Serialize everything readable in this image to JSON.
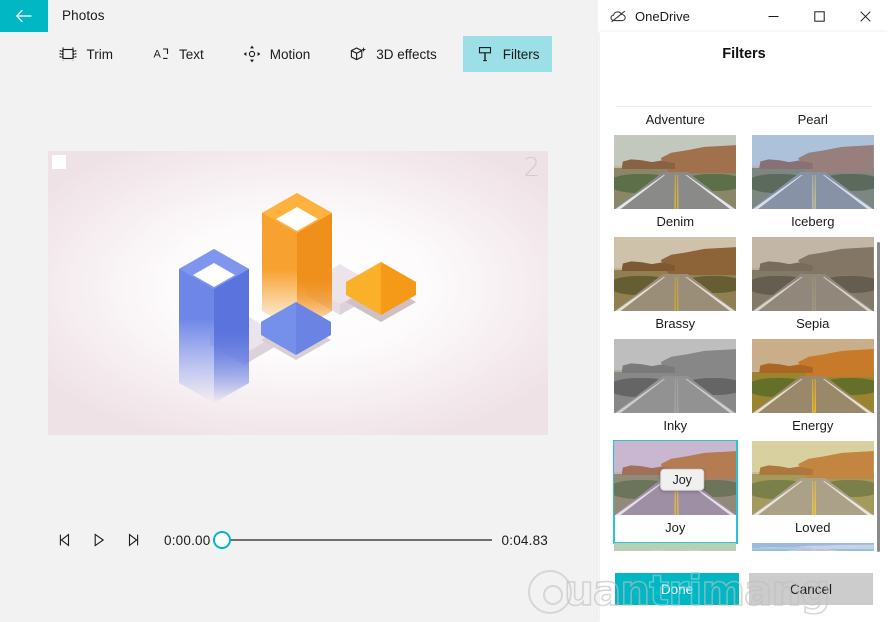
{
  "app": {
    "title": "Photos",
    "back_icon": "back-arrow-icon",
    "accent_color": "#00b7c3"
  },
  "toolbar": {
    "items": [
      {
        "label": "Trim",
        "icon": "trim-icon",
        "selected": false
      },
      {
        "label": "Text",
        "icon": "text-icon",
        "selected": false
      },
      {
        "label": "Motion",
        "icon": "motion-icon",
        "selected": false
      },
      {
        "label": "3D effects",
        "icon": "three-d-effects-icon",
        "selected": false
      },
      {
        "label": "Filters",
        "icon": "filters-brush-icon",
        "selected": true
      }
    ]
  },
  "preview": {
    "badge": "2",
    "corner_mark": "white-square-marker"
  },
  "transport": {
    "prev_frame_icon": "previous-frame-icon",
    "play_icon": "play-icon",
    "next_frame_icon": "next-frame-icon",
    "current_time": "0:00.00",
    "total_time": "0:04.83",
    "thumb_position_pct": 0
  },
  "window": {
    "app_name": "OneDrive",
    "app_icon": "onedrive-cloud-icon",
    "minimize_label": "—",
    "maximize_label": "☐",
    "close_label": "✕"
  },
  "filters_panel": {
    "title": "Filters",
    "selected_filter": "Joy",
    "tooltip": "Joy",
    "filters": [
      {
        "label": "Adventure",
        "thumb_hidden": true,
        "sky": "#b9cbd6",
        "mesa": "#a8764d",
        "rock": "#95683f",
        "ground": "#8f8a6a",
        "bush": "#5f6e44",
        "road": "#8e8d8b",
        "line": "#d8b13c",
        "tint": "rgba(120,90,60,0.08)"
      },
      {
        "label": "Pearl",
        "thumb_hidden": true,
        "sky": "#d6dce6",
        "mesa": "#b99a84",
        "rock": "#a89183",
        "ground": "#b3ad9a",
        "bush": "#8a9179",
        "road": "#aeaeae",
        "line": "#d9c58c",
        "tint": "rgba(235,230,235,0.22)"
      },
      {
        "label": "Denim",
        "sky": "#c9cec2",
        "mesa": "#a5714a",
        "rock": "#8d603d",
        "ground": "#8d8968",
        "bush": "#5d6f45",
        "road": "#8d8c8a",
        "line": "#dbb33f",
        "tint": "rgba(110,120,140,0.06)"
      },
      {
        "label": "Iceberg",
        "sky": "#b9ccdf",
        "mesa": "#9e7a6c",
        "rock": "#8a6a62",
        "ground": "#7e8472",
        "bush": "#566046",
        "road": "#8b92a0",
        "line": "#c7c48e",
        "tint": "rgba(120,150,200,0.18)"
      },
      {
        "label": "Brassy",
        "sky": "#d7cfbd",
        "mesa": "#8a6038",
        "rock": "#775331",
        "ground": "#8d8155",
        "bush": "#5d5a33",
        "road": "#9a9284",
        "line": "#cbab43",
        "tint": "rgba(160,120,55,0.14)"
      },
      {
        "label": "Sepia",
        "sky": "#d0c9bd",
        "mesa": "#7e7265",
        "rock": "#6e6459",
        "ground": "#7d7668",
        "bush": "#56504a",
        "road": "#8f8a82",
        "line": "#a39a86",
        "tint": "rgba(150,130,105,0.25)"
      },
      {
        "label": "Inky",
        "sky": "#d9d9d9",
        "mesa": "#8a8a8a",
        "rock": "#777777",
        "ground": "#8b8b8b",
        "bush": "#5a5a5a",
        "road": "#9a9a9a",
        "line": "#b0b0b0",
        "tint": "rgba(128,128,128,0.30)"
      },
      {
        "label": "Energy",
        "sky": "#c8b49c",
        "mesa": "#c4762c",
        "rock": "#a35f23",
        "ground": "#8e8233",
        "bush": "#4e6a2a",
        "road": "#8d8878",
        "line": "#e6bb33",
        "tint": "rgba(220,140,40,0.16)"
      },
      {
        "label": "Joy",
        "selected": true,
        "sky": "#cdbfd6",
        "mesa": "#b5793f",
        "rock": "#9e6a45",
        "ground": "#8c8a6b",
        "bush": "#5f7048",
        "road": "#9a90a0",
        "line": "#e2bb3c",
        "tint": "rgba(180,140,190,0.16)"
      },
      {
        "label": "Loved",
        "sky": "#d9d6a8",
        "mesa": "#c07b35",
        "rock": "#a56830",
        "ground": "#9a9355",
        "bush": "#687240",
        "road": "#a39a8c",
        "line": "#e8c23f",
        "tint": "rgba(210,190,120,0.18)"
      },
      {
        "label": "",
        "partial": true,
        "sky": "#b8d0b4",
        "mesa": "#b8d0b4",
        "rock": "#b8d0b4",
        "ground": "#b8d0b4",
        "bush": "#b8d0b4",
        "road": "#b8d0b4",
        "line": "#b8d0b4",
        "tint": "rgba(0,0,0,0)"
      },
      {
        "label": "",
        "partial": true,
        "sky": "#9eb7e0",
        "mesa": "#c8d2e4",
        "rock": "#bcc8de",
        "ground": "#a9c9dd",
        "bush": "#8fc3d8",
        "road": "#b2c4e0",
        "line": "#cfd9ea",
        "tint": "rgba(0,0,0,0)"
      }
    ],
    "done_label": "Done",
    "cancel_label": "Cancel"
  },
  "watermark": {
    "text_plain": "uan",
    "text_accent": "tri",
    "text_plain2": "mang",
    "mark": "gear-circle-logo"
  }
}
